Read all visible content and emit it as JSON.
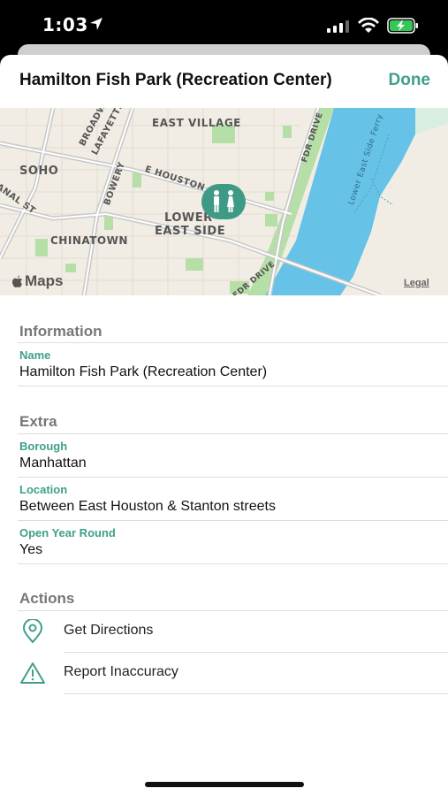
{
  "status_bar": {
    "time": "1:03"
  },
  "header": {
    "title": "Hamilton Fish Park (Recreation Center)",
    "done_label": "Done"
  },
  "map": {
    "labels": {
      "east_village": "EAST VILLAGE",
      "broadway": "BROADWAY",
      "lafayette": "LAFAYETTE S",
      "soho": "SOHO",
      "houston": "E HOUSTON",
      "bowery": "BOWERY",
      "canal": "ANAL ST",
      "lower_east_side_1": "LOWER",
      "lower_east_side_2": "EAST SIDE",
      "chinatown": "CHINATOWN",
      "fdr_drive_top": "FDR DRIVE",
      "fdr_drive_bottom": "FDR DRIVE",
      "ferry": "Lower East Side Ferry"
    },
    "logo_text": "Maps",
    "legal": "Legal"
  },
  "information": {
    "header": "Information",
    "name_label": "Name",
    "name_value": "Hamilton Fish Park (Recreation Center)"
  },
  "extra": {
    "header": "Extra",
    "borough_label": "Borough",
    "borough_value": "Manhattan",
    "location_label": "Location",
    "location_value": "Between East Houston & Stanton streets",
    "open_label": "Open Year Round",
    "open_value": "Yes"
  },
  "actions": {
    "header": "Actions",
    "directions_label": "Get Directions",
    "report_label": "Report Inaccuracy"
  },
  "colors": {
    "accent": "#3f9f8a",
    "water": "#66c2e6",
    "park": "#b5dfa6"
  }
}
